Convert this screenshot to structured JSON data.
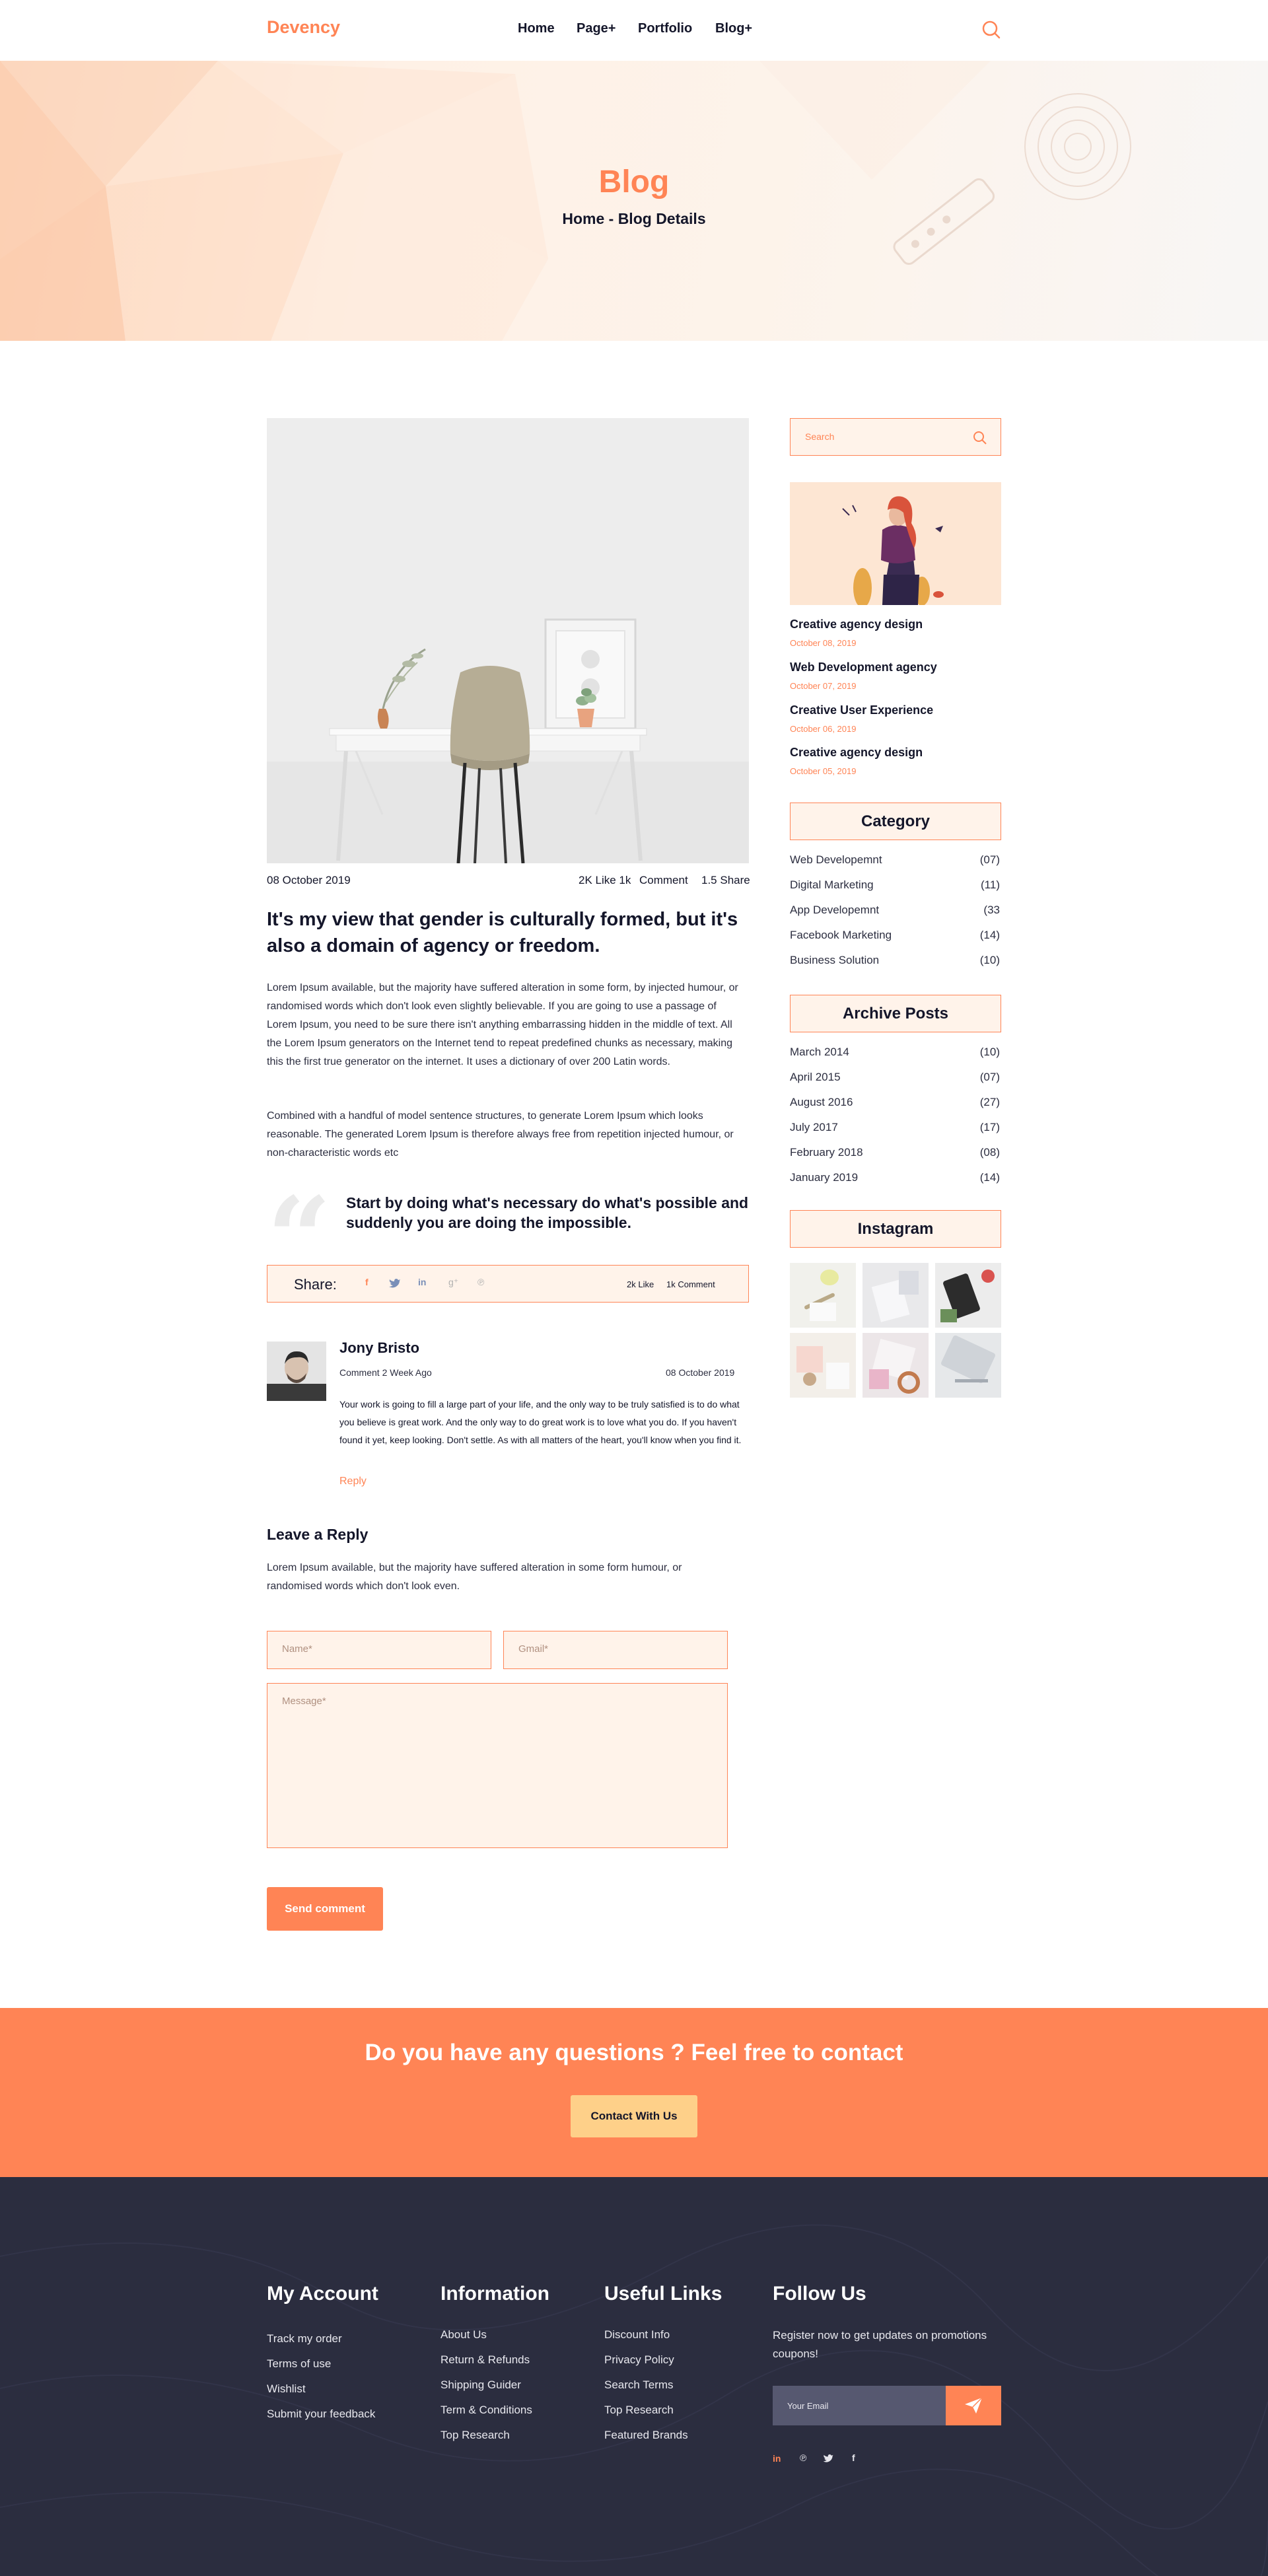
{
  "header": {
    "logo": "Devency",
    "nav": [
      "Home",
      "Page+",
      "Portfolio",
      "Blog+"
    ]
  },
  "hero": {
    "title": "Blog",
    "breadcrumb": "Home - Blog Details"
  },
  "post": {
    "date": "08 October 2019",
    "likes": "2K Like 1k",
    "comment": "Comment",
    "share": "1.5 Share",
    "title": "It's my view that gender is culturally formed, but it's also a domain of agency or freedom.",
    "paragraph1": "Lorem Ipsum available, but the majority have suffered alteration in some form, by injected humour, or randomised words which don't look even slightly believable. If you are going to use a passage of Lorem Ipsum, you need to be sure there isn't anything embarrassing hidden in the middle of text. All the Lorem Ipsum generators on the Internet tend to repeat predefined chunks as necessary, making this the first true generator on the internet. It uses a dictionary of over 200 Latin words.",
    "paragraph2": "Combined with a handful of model sentence structures, to generate Lorem Ipsum which looks reasonable. The generated Lorem Ipsum is therefore always free from repetition injected humour, or non-characteristic words etc",
    "quote": "Start by doing what's necessary do what's possible and suddenly you are doing the impossible."
  },
  "share_bar": {
    "label": "Share:",
    "icons": [
      "facebook-icon",
      "twitter-icon",
      "linkedin-icon",
      "google-plus-icon",
      "pinterest-icon"
    ],
    "likes": "2k Like",
    "comments": "1k Comment"
  },
  "comment": {
    "author": "Jony Bristo",
    "ago": "Comment 2 Week Ago",
    "date": "08 October 2019",
    "text": "Your work is going to fill a large part of your life, and the only way to be truly satisfied is to do what you believe is great work. And the only way to do great work is to love what you do. If you haven't found it yet, keep looking. Don't settle. As with all matters of the heart, you'll know when you find it.",
    "reply": "Reply"
  },
  "reply_form": {
    "heading": "Leave a Reply",
    "intro": "Lorem Ipsum available, but the majority have suffered alteration in some form humour, or randomised words which don't look even.",
    "name_placeholder": "Name*",
    "email_placeholder": "Gmail*",
    "message_placeholder": "Message*",
    "submit": "Send comment"
  },
  "sidebar": {
    "search_placeholder": "Search",
    "recent": [
      {
        "title": "Creative agency design",
        "date": "October 08, 2019"
      },
      {
        "title": "Web Development agency",
        "date": "October 07, 2019"
      },
      {
        "title": "Creative User Experience",
        "date": "October 06, 2019"
      },
      {
        "title": "Creative agency design",
        "date": "October 05, 2019"
      }
    ],
    "category_heading": "Category",
    "categories": [
      {
        "name": "Web Developemnt",
        "count": "(07)"
      },
      {
        "name": "Digital Marketing",
        "count": "(11)"
      },
      {
        "name": "App Developemnt",
        "count": "(33"
      },
      {
        "name": "Facebook Marketing",
        "count": "(14)"
      },
      {
        "name": "Business Solution",
        "count": "(10)"
      }
    ],
    "archive_heading": "Archive Posts",
    "archives": [
      {
        "name": "March 2014",
        "count": "(10)"
      },
      {
        "name": "April 2015",
        "count": "(07)"
      },
      {
        "name": "August 2016",
        "count": "(27)"
      },
      {
        "name": "July 2017",
        "count": "(17)"
      },
      {
        "name": "February 2018",
        "count": "(08)"
      },
      {
        "name": "January 2019",
        "count": "(14)"
      }
    ],
    "instagram_heading": "Instagram"
  },
  "cta": {
    "title": "Do you have any questions ? Feel free to contact",
    "button": "Contact With Us"
  },
  "footer": {
    "my_account": {
      "heading": "My Account",
      "links": [
        "Track my order",
        "Terms of use",
        "Wishlist",
        "Submit your feedback"
      ]
    },
    "information": {
      "heading": "Information",
      "links": [
        "About Us",
        "Return & Refunds",
        "Shipping Guider",
        "Term & Conditions",
        "Top Research"
      ]
    },
    "useful": {
      "heading": "Useful Links",
      "links": [
        "Discount Info",
        "Privacy Policy",
        "Search Terms",
        "Top Research",
        "Featured Brands"
      ]
    },
    "follow": {
      "heading": "Follow Us",
      "text": "Register now to get updates on promotions coupons!",
      "email_placeholder": "Your Email",
      "socials": [
        "linkedin-icon",
        "pinterest-icon",
        "twitter-icon",
        "facebook-icon"
      ]
    }
  },
  "colors": {
    "accent": "#ff8455",
    "light_accent": "#fff3ea",
    "dark": "#2b2d3f",
    "cta_button": "#fed089"
  }
}
